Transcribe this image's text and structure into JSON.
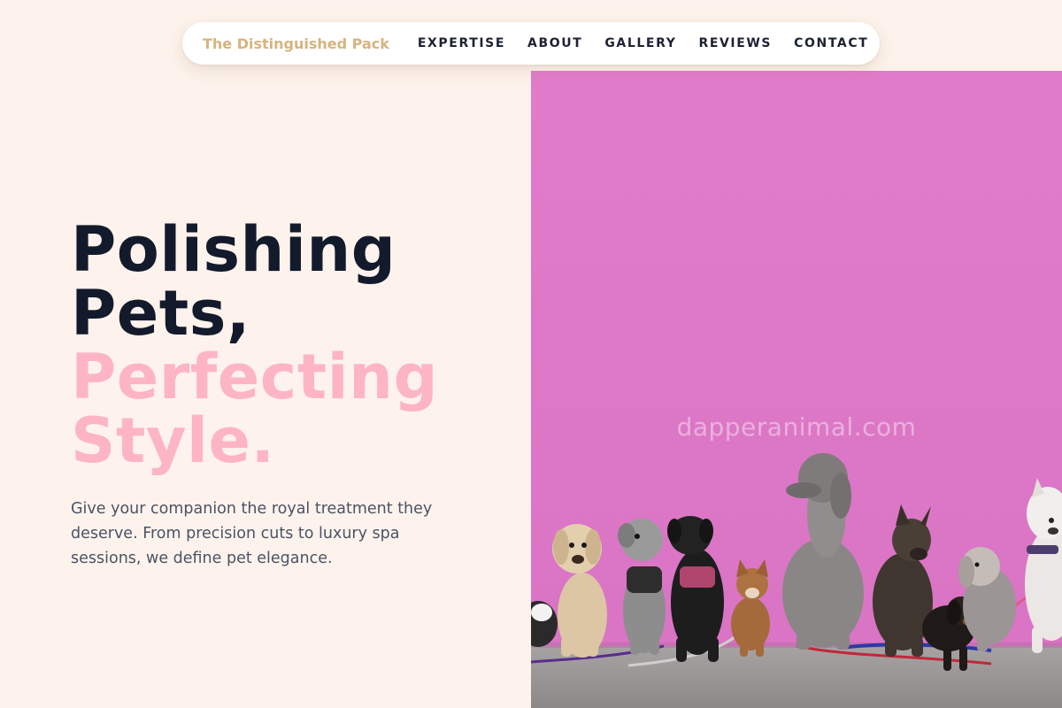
{
  "nav": {
    "brand": "The Distinguished Pack",
    "links": [
      "EXPERTISE",
      "ABOUT",
      "GALLERY",
      "REVIEWS",
      "CONTACT"
    ]
  },
  "hero": {
    "title_line1": "Polishing",
    "title_line2": "Pets,",
    "title_accent_line1": "Perfecting",
    "title_accent_line2": "Style.",
    "subtitle": "Give your companion the royal treatment they deserve. From precision cuts to luxury spa sessions, we define pet elegance."
  },
  "image": {
    "watermark": "dapperanimal.com"
  },
  "colors": {
    "background": "#fdf3ec",
    "brand": "#d6b47f",
    "heading": "#131a2c",
    "accent_pink": "#fdb5c4",
    "body_text": "#4a5366",
    "wall_pink": "#df78c8"
  }
}
